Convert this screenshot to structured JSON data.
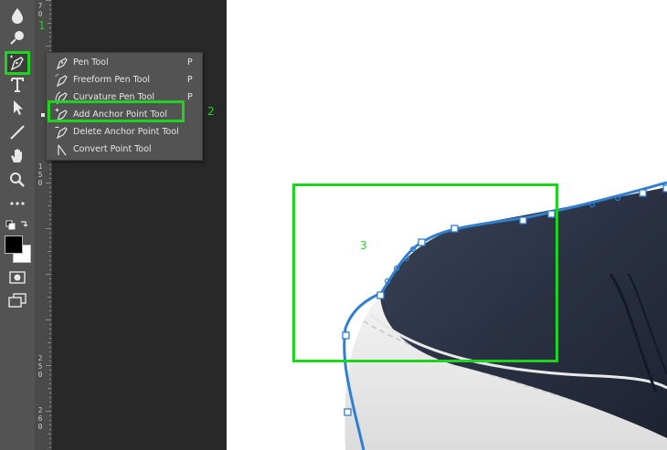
{
  "ruler": {
    "digits_top": [
      "7",
      "0"
    ],
    "digits_mid": [
      "1",
      "5",
      "0"
    ],
    "digits_low": [
      "2",
      "5",
      "0"
    ],
    "digits_lower": [
      "2",
      "6",
      "0"
    ]
  },
  "tools": [
    {
      "name": "blur-tool",
      "icon": "water-drop-icon"
    },
    {
      "name": "dodge-tool",
      "icon": "dodge-icon"
    },
    {
      "name": "pen-tool",
      "icon": "pen-icon"
    },
    {
      "name": "type-tool",
      "icon": "type-icon"
    },
    {
      "name": "path-selection-tool",
      "icon": "arrow-icon"
    },
    {
      "name": "line-tool",
      "icon": "line-icon"
    },
    {
      "name": "hand-tool",
      "icon": "hand-icon"
    },
    {
      "name": "zoom-tool",
      "icon": "magnifier-icon"
    },
    {
      "name": "edit-toolbar",
      "icon": "ellipsis-icon"
    },
    {
      "name": "default-colors",
      "icon": "default-colors-icon"
    },
    {
      "name": "quick-mask",
      "icon": "quick-mask-icon"
    },
    {
      "name": "screen-mode",
      "icon": "screen-mode-icon"
    }
  ],
  "flyout": {
    "items": [
      {
        "label": "Pen Tool",
        "shortcut": "P",
        "icon": "pen-icon",
        "active": false
      },
      {
        "label": "Freeform Pen Tool",
        "shortcut": "P",
        "icon": "freeform-pen-icon",
        "active": false
      },
      {
        "label": "Curvature Pen Tool",
        "shortcut": "P",
        "icon": "curvature-pen-icon",
        "active": false
      },
      {
        "label": "Add Anchor Point Tool",
        "shortcut": "",
        "icon": "add-anchor-point-icon",
        "active": true
      },
      {
        "label": "Delete Anchor Point Tool",
        "shortcut": "",
        "icon": "delete-anchor-point-icon",
        "active": false
      },
      {
        "label": "Convert Point Tool",
        "shortcut": "",
        "icon": "convert-point-icon",
        "active": false
      }
    ]
  },
  "callouts": {
    "one": "1",
    "two": "2",
    "three": "3"
  },
  "colors": {
    "highlight": "#1fd31f",
    "path": "#2f7fd0",
    "shoe": "#2c3446"
  }
}
